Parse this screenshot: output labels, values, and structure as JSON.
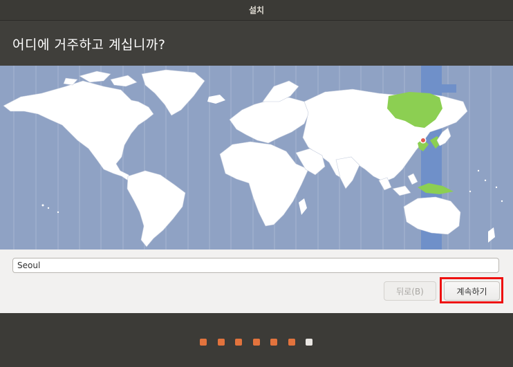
{
  "window": {
    "title": "설치"
  },
  "page": {
    "heading": "어디에 거주하고 계십니까?"
  },
  "timezone": {
    "value": "Seoul",
    "selected_location": "Seoul"
  },
  "buttons": {
    "back_label": "뒤로(B)",
    "next_label": "계속하기"
  },
  "progress": {
    "total_steps": 7,
    "current_step": 7,
    "completed_steps": 6
  },
  "colors": {
    "ocean": "#8fa2c4",
    "land": "#ffffff",
    "selected_timezone_band": "#6f90c9",
    "selected_timezone_land": "#8ccf52",
    "location_pin": "#e05a50",
    "progress_done": "#e2733d",
    "progress_current": "#e9e6e2",
    "highlight": "#ee1010"
  }
}
